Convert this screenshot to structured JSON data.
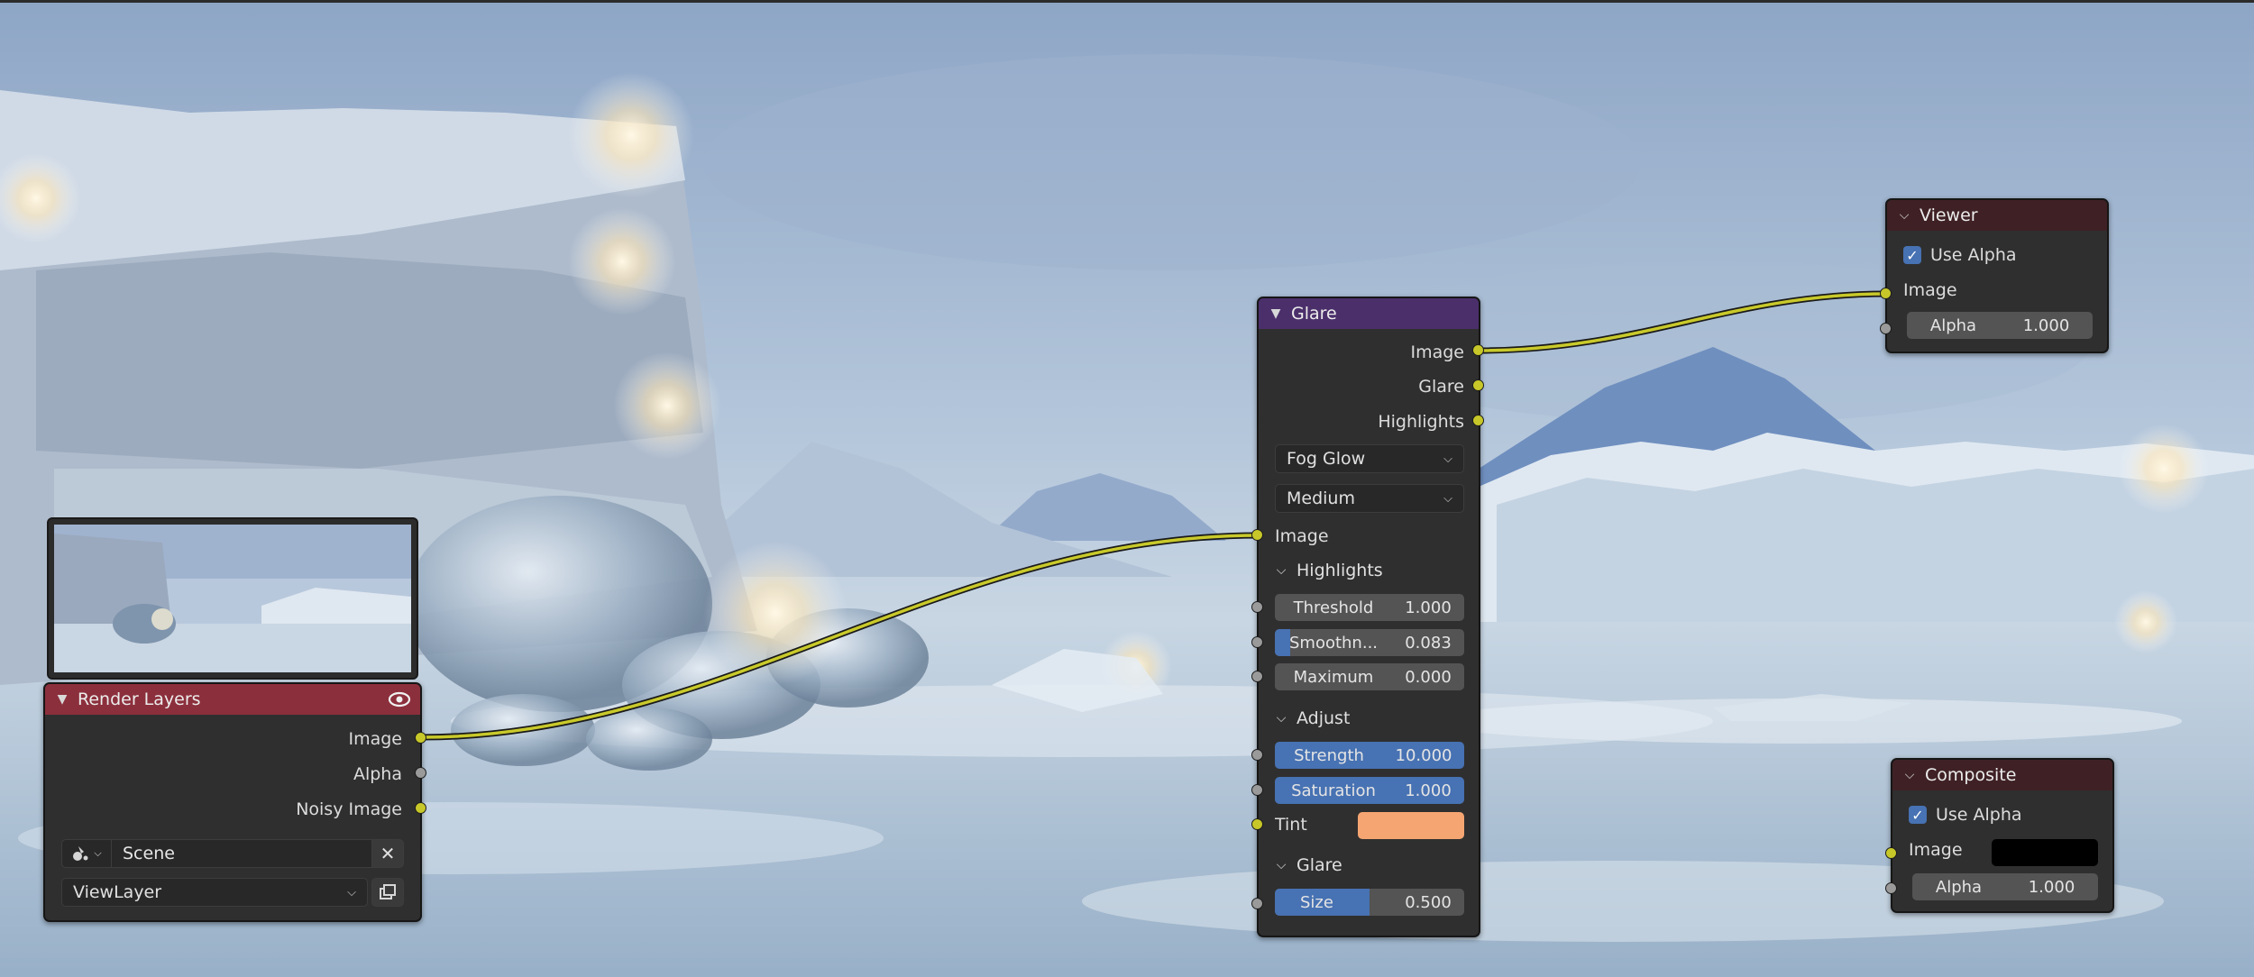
{
  "render_layers": {
    "title": "Render Layers",
    "outputs": [
      "Image",
      "Alpha",
      "Noisy Image"
    ],
    "scene_label": "Scene",
    "view_layer_label": "ViewLayer"
  },
  "glare": {
    "title": "Glare",
    "outputs": [
      "Image",
      "Glare",
      "Highlights"
    ],
    "glare_type": "Fog Glow",
    "quality": "Medium",
    "input_image": "Image",
    "highlights": {
      "title": "Highlights",
      "threshold_label": "Threshold",
      "threshold_value": "1.000",
      "smoothness_label": "Smoothn...",
      "smoothness_value": "0.083",
      "smoothness_fill": 0.083,
      "maximum_label": "Maximum",
      "maximum_value": "0.000"
    },
    "adjust": {
      "title": "Adjust",
      "strength_label": "Strength",
      "strength_value": "10.000",
      "saturation_label": "Saturation",
      "saturation_value": "1.000",
      "tint_label": "Tint",
      "tint_color": "#f5a572"
    },
    "glare_section": {
      "title": "Glare",
      "size_label": "Size",
      "size_value": "0.500",
      "size_fill": 0.5
    }
  },
  "viewer": {
    "title": "Viewer",
    "use_alpha_label": "Use Alpha",
    "image_label": "Image",
    "alpha_label": "Alpha",
    "alpha_value": "1.000"
  },
  "composite": {
    "title": "Composite",
    "use_alpha_label": "Use Alpha",
    "image_label": "Image",
    "alpha_label": "Alpha",
    "alpha_value": "1.000"
  },
  "colors": {
    "accent": "#4772b3",
    "socket_color": "#c7c729",
    "render_layers_header": "#8c2f3c",
    "glare_header": "#4b2f6b",
    "output_header": "#3f2125"
  }
}
